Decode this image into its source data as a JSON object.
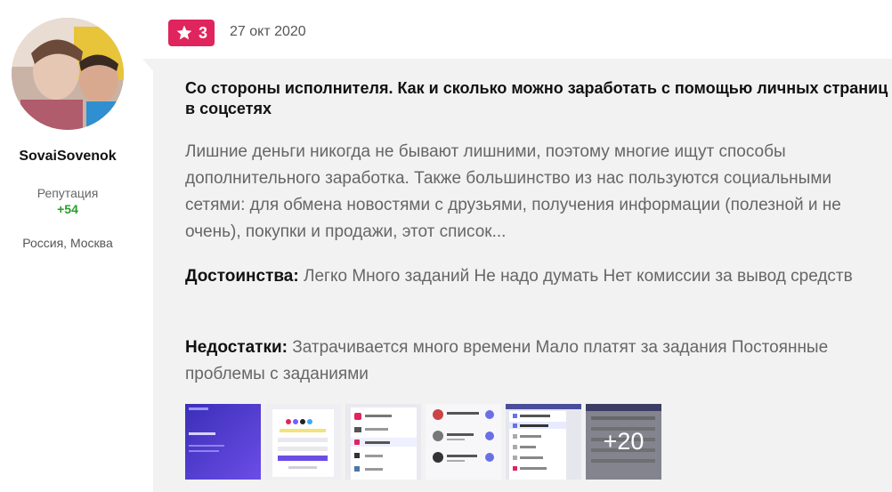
{
  "user": {
    "name": "SovaiSovenok",
    "reputation_label": "Репутация",
    "reputation_value": "+54",
    "location": "Россия, Москва"
  },
  "review": {
    "rating": "3",
    "date": "27 окт 2020",
    "title": "Со стороны исполнителя. Как и сколько можно заработать с помощью личных страниц в соцсетях",
    "excerpt": "Лишние деньги никогда не бывают лишними, поэтому многие ищут способы дополнительного заработка. Также большинство из нас пользуются социальными сетями: для обмена новостями с друзьями, получения информации (полезной и не очень), покупки и продажи, этот список...",
    "pros_label": "Достоинства:",
    "pros_text": "Легко Много заданий Не надо думать Нет комиссии за вывод средств",
    "cons_label": "Недостатки:",
    "cons_text": "Затрачивается много времени Мало платят за задания Постоянные проблемы с заданиями",
    "more_photos": "+20"
  },
  "colors": {
    "badge": "#e0245e",
    "reputation": "#2a9d2a",
    "card_bg": "#f2f2f2"
  }
}
